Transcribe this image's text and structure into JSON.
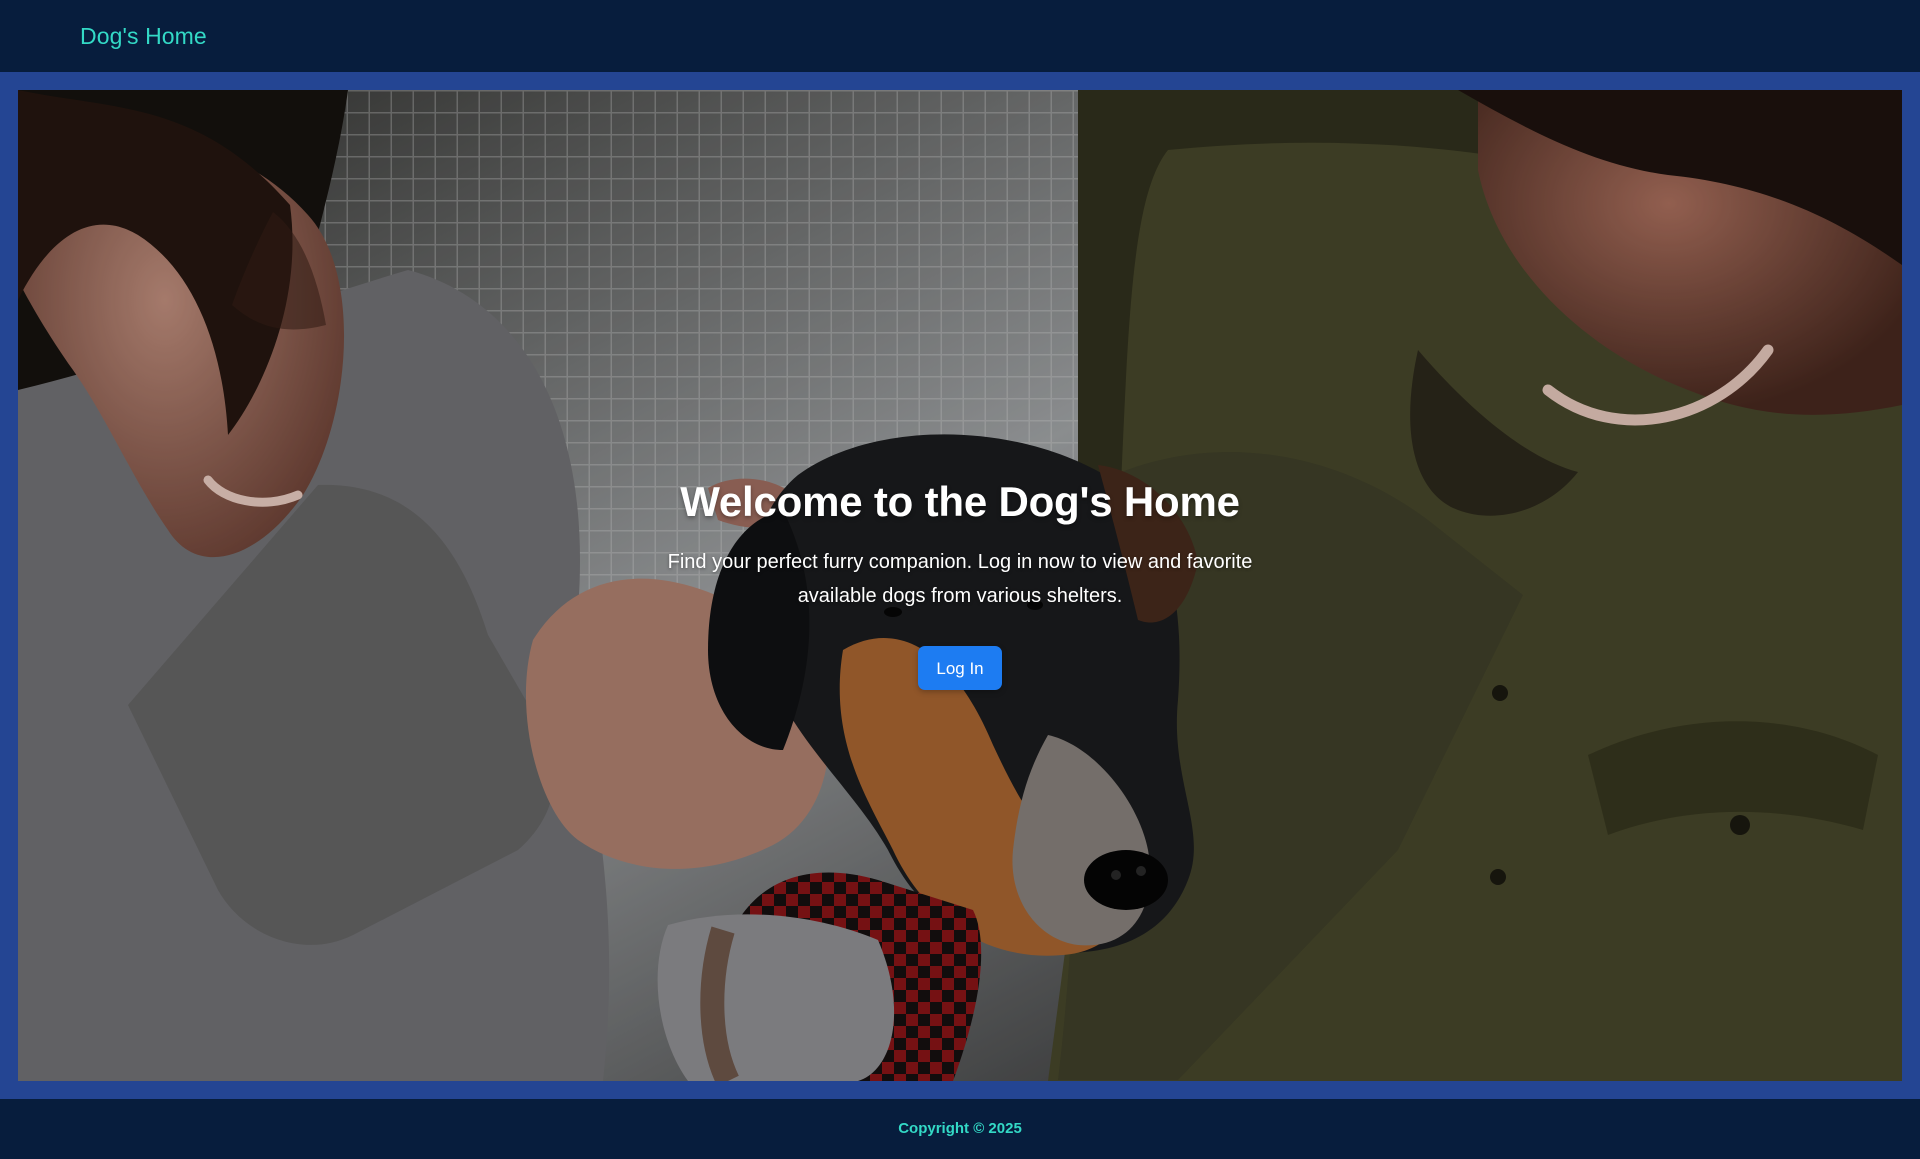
{
  "header": {
    "brand": "Dog's Home"
  },
  "hero": {
    "title": "Welcome to the Dog's Home",
    "description": "Find your perfect furry companion. Log in now to view and favorite available dogs from various shelters.",
    "login_button": "Log In"
  },
  "footer": {
    "copyright": "Copyright © 2025"
  },
  "colors": {
    "background": "#071d3d",
    "frame": "#244593",
    "accent": "#33d9c6",
    "primary_button": "#1d7cf2"
  }
}
